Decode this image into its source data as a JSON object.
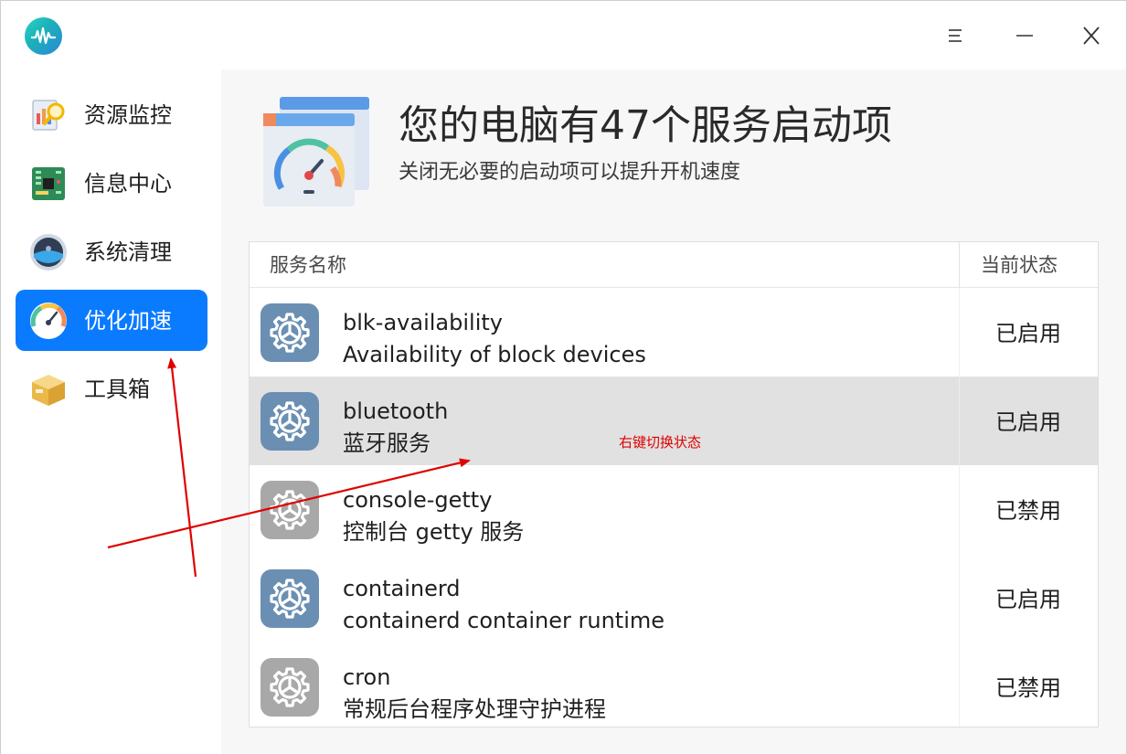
{
  "app": {
    "logo_icon": "waveform-logo-icon",
    "window_buttons": [
      "menu-icon",
      "minimize-icon",
      "close-icon"
    ]
  },
  "sidebar": {
    "items": [
      {
        "label": "资源监控",
        "icon": "resource-monitor-icon",
        "active": false
      },
      {
        "label": "信息中心",
        "icon": "circuit-board-icon",
        "active": false
      },
      {
        "label": "系统清理",
        "icon": "disk-cleanup-icon",
        "active": false
      },
      {
        "label": "优化加速",
        "icon": "speedometer-icon",
        "active": true
      },
      {
        "label": "工具箱",
        "icon": "toolbox-icon",
        "active": false
      }
    ]
  },
  "header": {
    "title": "您的电脑有47个服务启动项",
    "subtitle": "关闭无必要的启动项可以提升开机速度",
    "icon": "startup-speedometer-icon"
  },
  "table": {
    "columns": {
      "name": "服务名称",
      "status": "当前状态"
    },
    "rows": [
      {
        "name": "blk-availability",
        "desc": "Availability of block devices",
        "status": "已启用",
        "enabled": true
      },
      {
        "name": "bluetooth",
        "desc": "蓝牙服务",
        "status": "已启用",
        "enabled": true
      },
      {
        "name": "console-getty",
        "desc": "控制台 getty 服务",
        "status": "已禁用",
        "enabled": false
      },
      {
        "name": "containerd",
        "desc": "containerd container runtime",
        "status": "已启用",
        "enabled": true
      },
      {
        "name": "cron",
        "desc": "常规后台程序处理守护进程",
        "status": "已禁用",
        "enabled": false
      }
    ]
  },
  "annotation": {
    "text": "右键切换状态",
    "color": "#e00000"
  },
  "colors": {
    "accent": "#0a7bff",
    "enabled_icon": "#6a8fb2",
    "disabled_icon": "#a8a8a8",
    "selected_row": "#e1e1e1"
  }
}
